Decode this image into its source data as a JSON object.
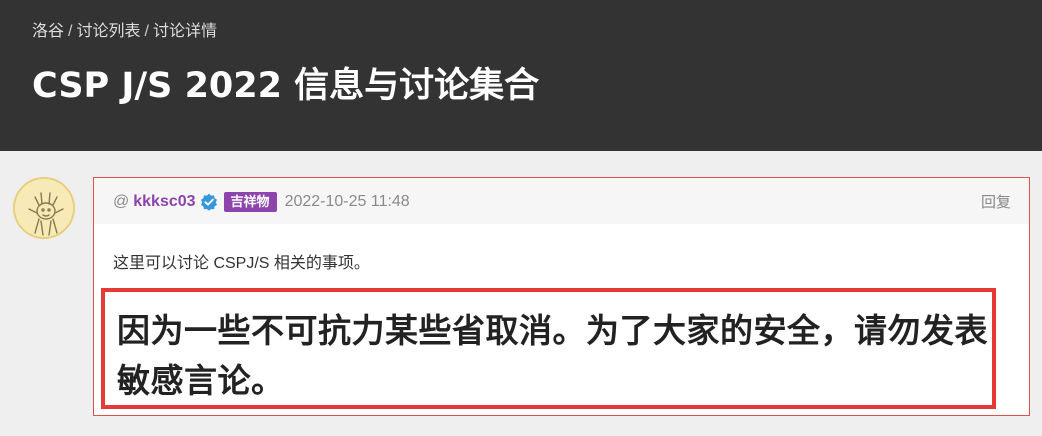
{
  "breadcrumb": {
    "items": [
      "洛谷",
      "讨论列表",
      "讨论详情"
    ],
    "separator": "/"
  },
  "page_title": "CSP J/S 2022 信息与讨论集合",
  "post": {
    "at_symbol": "@",
    "username": "kkksc03",
    "badge": "吉祥物",
    "timestamp": "2022-10-25 11:48",
    "reply_label": "回复",
    "body_text": "这里可以讨论 CSPJ/S 相关的事项。",
    "notice_text": "因为一些不可抗力某些省取消。为了大家的安全，请勿发表敏感言论。"
  },
  "colors": {
    "header_bg": "#333333",
    "username": "#8e44ad",
    "badge_bg": "#8e44ad",
    "verified": "#3498db",
    "notice_border": "#e53935",
    "card_border": "#d9534f"
  },
  "icons": {
    "verified": "verified-check-icon",
    "avatar": "user-avatar"
  }
}
